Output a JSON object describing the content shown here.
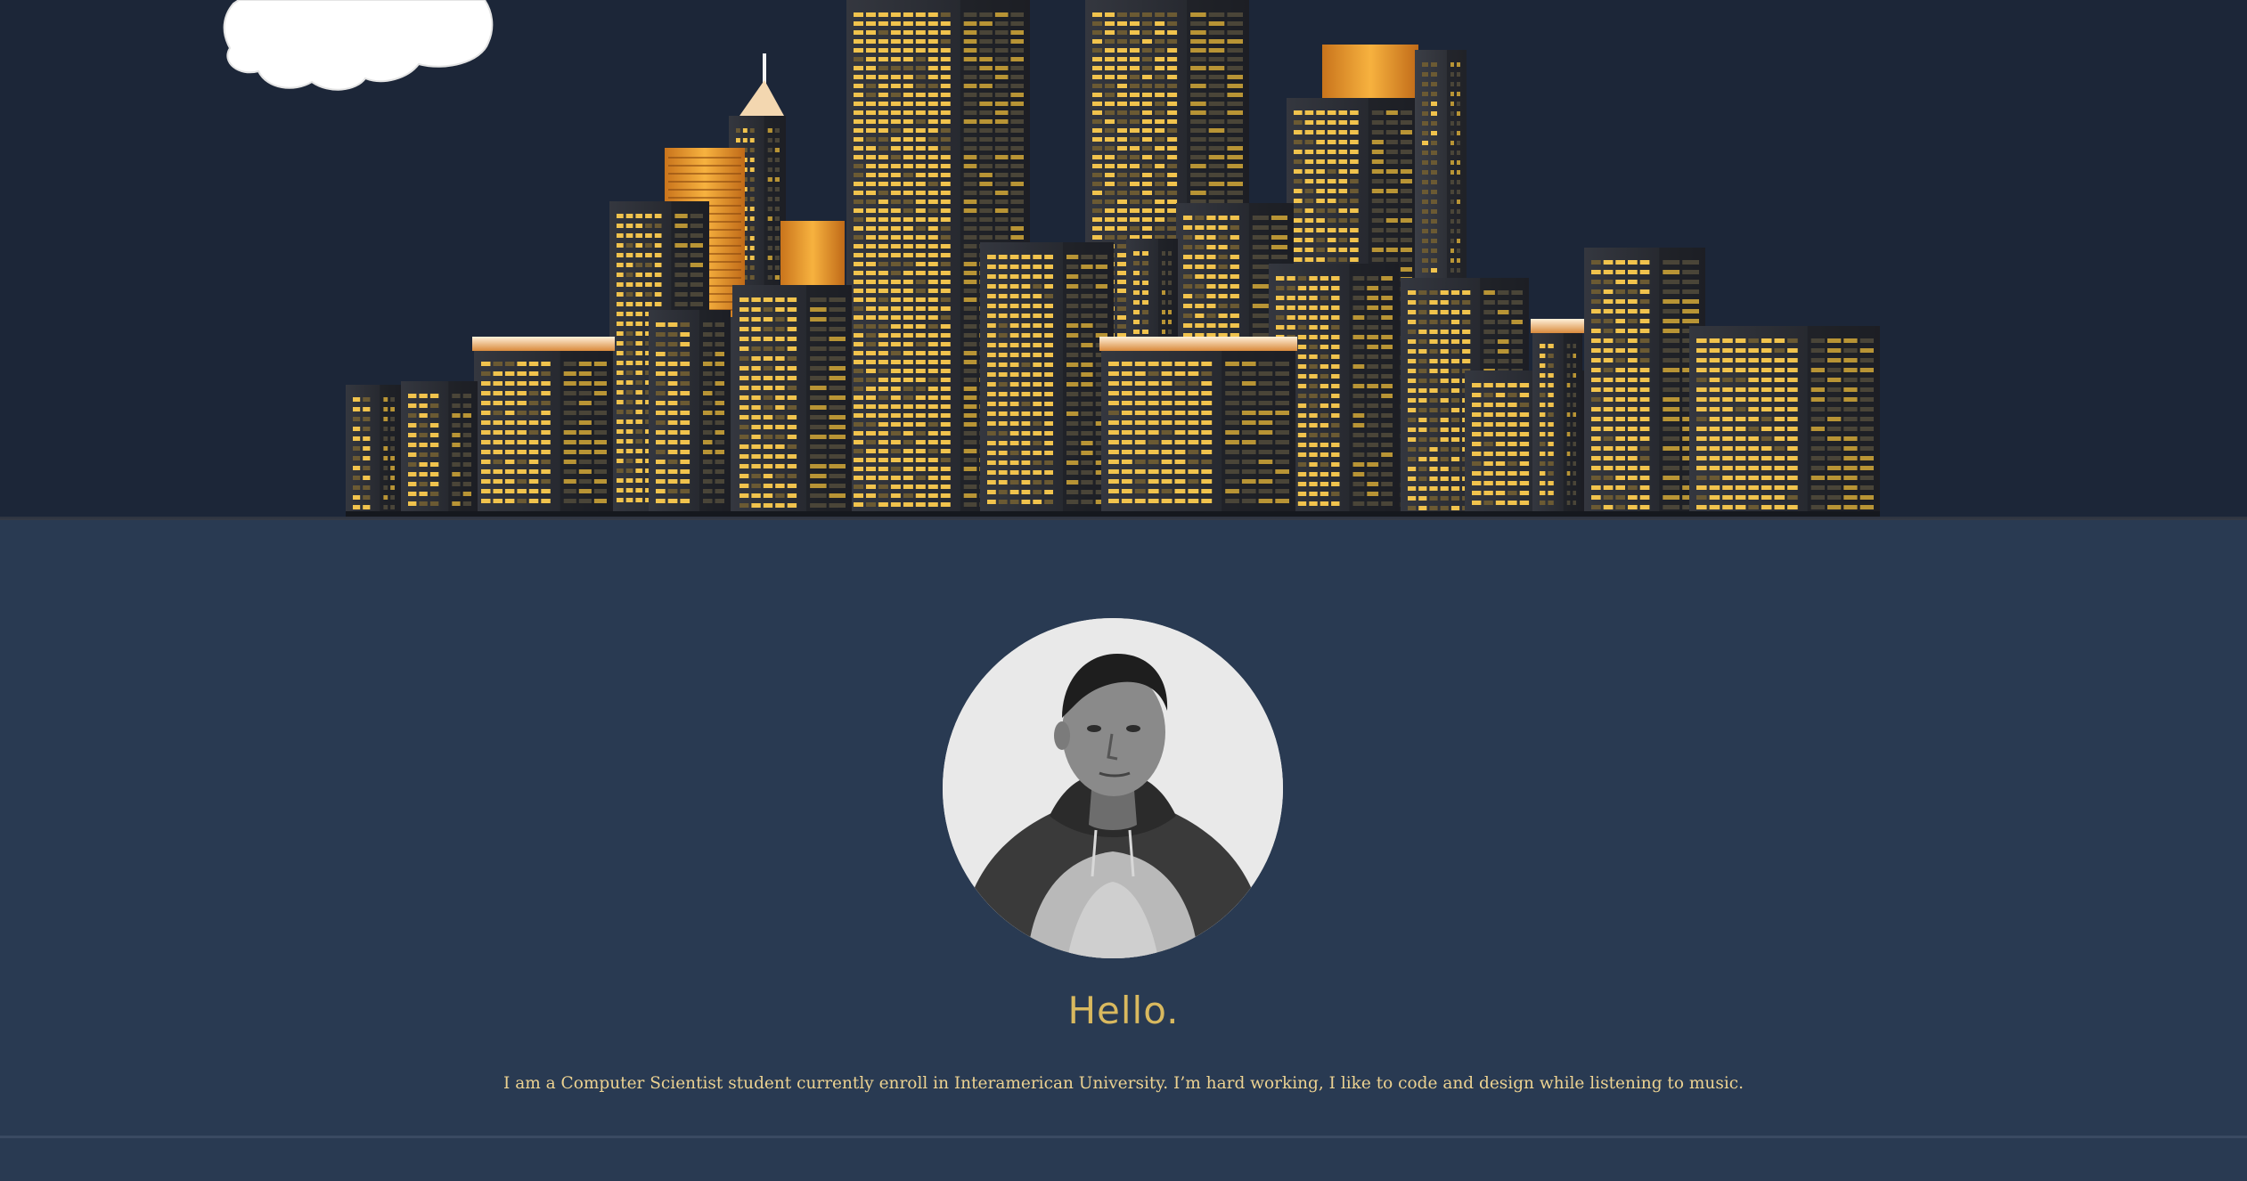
{
  "hero": {
    "illustration": "night-city-skyline",
    "colors": {
      "sky": "#1c2638",
      "building_dark": "#2a2d35",
      "window_lit": "#f1c34d",
      "window_dim": "#6b5a33",
      "cloud": "#ffffff"
    }
  },
  "profile": {
    "photo": "profile-portrait",
    "greeting": "Hello.",
    "bio": "I am a Computer Scientist student currently enroll in Interamerican University. I’m hard working, I like to code and design while listening to music."
  },
  "colors": {
    "section_background": "#293a52",
    "greeting_text": "#d9b95f",
    "bio_text": "#ecd291"
  }
}
